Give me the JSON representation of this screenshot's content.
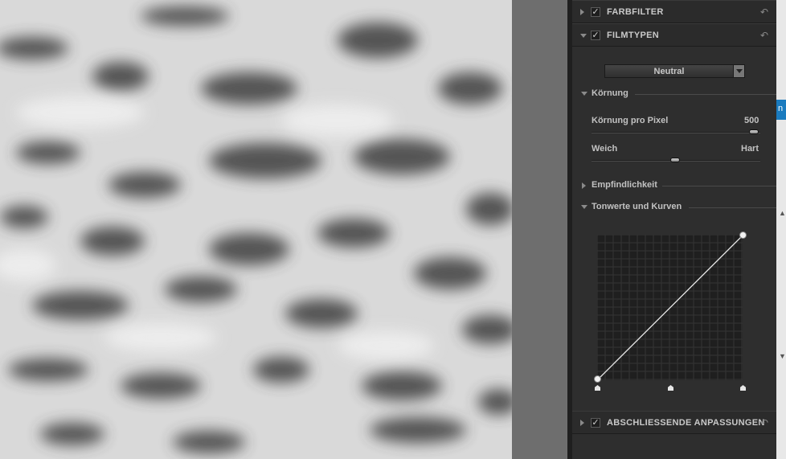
{
  "panel": {
    "sections": {
      "farbfilter": {
        "title": "FARBFILTER",
        "enabled": true,
        "expanded": false
      },
      "filmtypen": {
        "title": "FILMTYPEN",
        "enabled": true,
        "expanded": true
      },
      "abschluss": {
        "title": "ABSCHLIESSENDE ANPASSUNGEN",
        "enabled": true,
        "expanded": false
      }
    },
    "check_glyph": "✓",
    "reset_glyph": "↶",
    "filmtype_select": {
      "value": "Neutral"
    },
    "koernung": {
      "label": "Körnung",
      "pro_pixel": {
        "label": "Körnung pro Pixel",
        "value": "500",
        "fraction": 0.96
      },
      "weich_hart": {
        "min_label": "Weich",
        "max_label": "Hart",
        "fraction": 0.5
      }
    },
    "empfindlichkeit": {
      "label": "Empfindlichkeit",
      "expanded": false
    },
    "tonwerte": {
      "label": "Tonwerte und Kurven",
      "expanded": true
    }
  },
  "edge": {
    "partial_text": "n"
  },
  "colors": {
    "panel": "#2e2e2e",
    "accent_blue": "#1a7bbf"
  }
}
